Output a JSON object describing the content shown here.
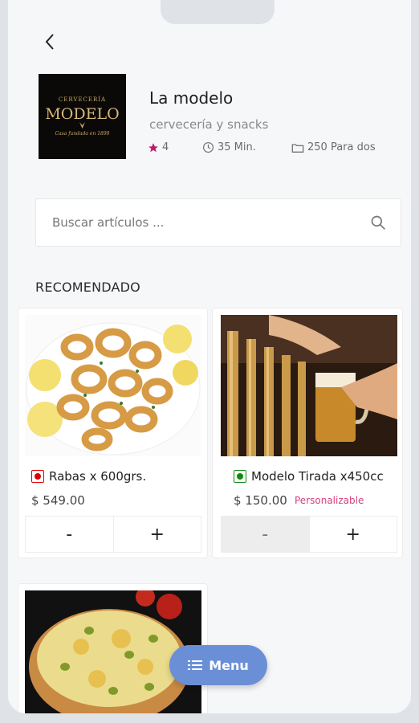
{
  "store": {
    "logo_text_top": "CERVECERÍA",
    "logo_text_main": "MODELO",
    "logo_text_sub": "Casa fundada en 1899",
    "name": "La modelo",
    "description": "cervecería y snacks",
    "rating": "4",
    "delivery_time": "35 Min.",
    "price_for_two": "250 Para dos"
  },
  "search": {
    "placeholder": "Buscar artículos ..."
  },
  "section": {
    "title": "RECOMENDADO"
  },
  "products": [
    {
      "name": "Rabas x 600grs.",
      "price": "$ 549.00",
      "badge": "",
      "veg_color": "#e00000",
      "minus": "-",
      "plus": "+"
    },
    {
      "name": "Modelo Tirada x450cc",
      "price": "$ 150.00",
      "badge": "Personalizable",
      "veg_color": "#138a13",
      "minus": "-",
      "plus": "+"
    }
  ],
  "fab": {
    "label": "Menu"
  },
  "colors": {
    "accent": "#6b8fd6",
    "star": "#c2186b",
    "badge": "#d6407f"
  },
  "icons": [
    "back-arrow-icon",
    "star-icon",
    "clock-icon",
    "wallet-icon",
    "search-icon",
    "list-icon"
  ]
}
